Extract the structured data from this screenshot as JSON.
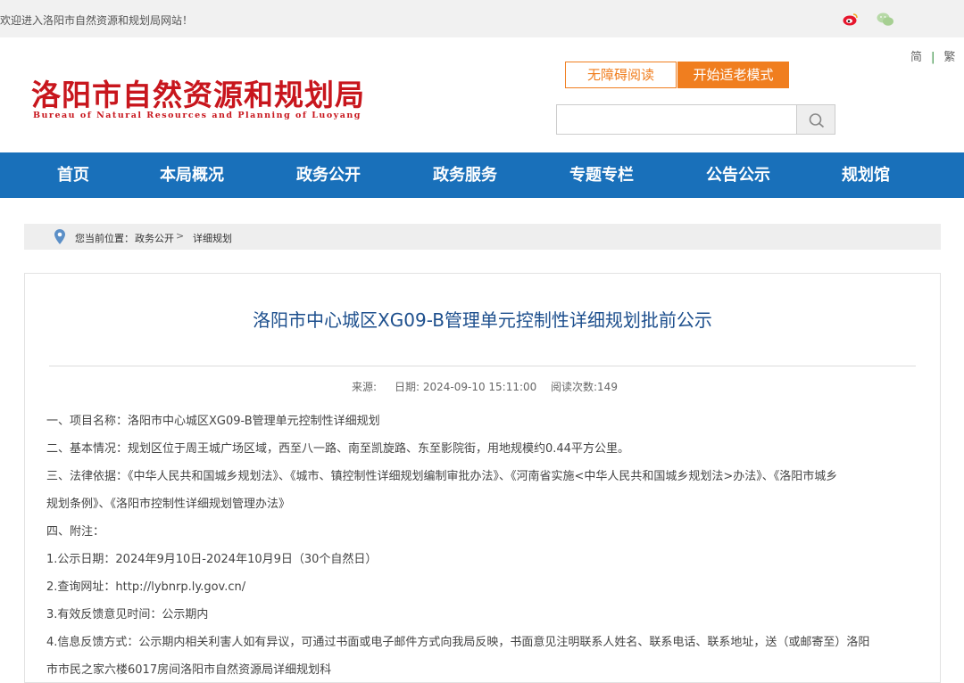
{
  "topbar": {
    "welcome": "欢迎进入洛阳市自然资源和规划局网站！",
    "icons": [
      "weibo-icon",
      "wechat-icon"
    ]
  },
  "header": {
    "logo_cn": "洛阳市自然资源和规划局",
    "logo_en": "Bureau of Natural Resources and Planning of Luoyang",
    "lang_simplified": "简",
    "lang_separator": "|",
    "lang_traditional": "繁",
    "accessibility_label": "无障碍阅读",
    "elder_mode_label": "开始适老模式",
    "search_value": "",
    "search_placeholder": ""
  },
  "nav": {
    "items": [
      "首页",
      "本局概况",
      "政务公开",
      "政务服务",
      "专题专栏",
      "公告公示",
      "规划馆"
    ]
  },
  "breadcrumb": {
    "label": "您当前位置：",
    "items": [
      "政务公开",
      "详细规划"
    ],
    "separator": ">"
  },
  "article": {
    "title": "洛阳市中心城区XG09-B管理单元控制性详细规划批前公示",
    "meta_source": "来源:",
    "meta_date": "日期:  2024-09-10 15:11:00",
    "meta_views": "阅读次数:149",
    "paragraphs": [
      "一、项目名称：洛阳市中心城区XG09-B管理单元控制性详细规划",
      "二、基本情况：规划区位于周王城广场区域，西至八一路、南至凯旋路、东至影院街，用地规模约0.44平方公里。",
      "三、法律依据：《中华人民共和国城乡规划法》、《城市、镇控制性详细规划编制审批办法》、《河南省实施<中华人民共和国城乡规划法>办法》、《洛阳市城乡",
      "规划条例》、《洛阳市控制性详细规划管理办法》",
      "四、附注：",
      "1.公示日期：2024年9月10日-2024年10月9日（30个自然日）",
      "2.查询网址：http://lybnrp.ly.gov.cn/",
      "3.有效反馈意见时间：公示期内",
      "4.信息反馈方式：公示期内相关利害人如有异议，可通过书面或电子邮件方式向我局反映，书面意见注明联系人姓名、联系电话、联系地址，送（或邮寄至）洛阳",
      "市市民之家六楼6017房间洛阳市自然资源局详细规划科"
    ]
  },
  "colors": {
    "nav_blue": "#1970ba",
    "logo_red": "#c8161d",
    "accent_orange": "#f07e1f",
    "title_blue": "#1d4f8d"
  }
}
